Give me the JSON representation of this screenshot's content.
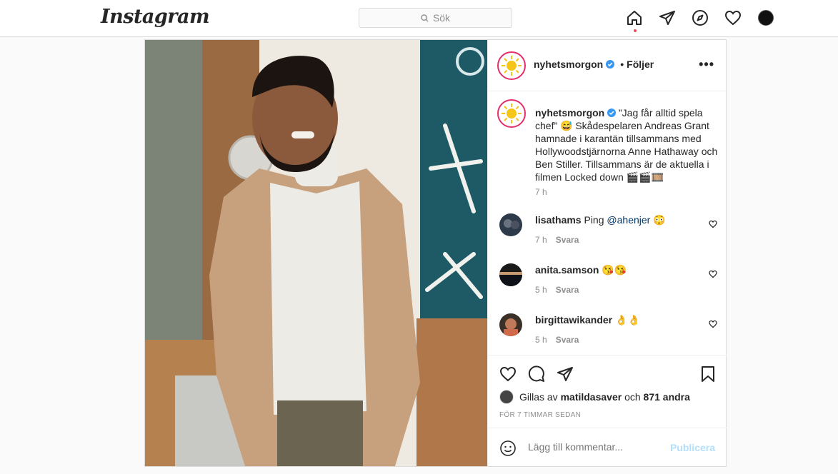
{
  "nav": {
    "logo": "Instagram",
    "search_placeholder": "Sök",
    "icons": [
      "home-icon",
      "direct-icon",
      "explore-icon",
      "activity-heart-icon",
      "profile-avatar"
    ]
  },
  "post": {
    "username": "nyhetsmorgon",
    "follow_separator": "•",
    "follow_label": "Följer",
    "more_label": "•••",
    "caption": "”Jag får alltid spela chef” 😅 Skådespelaren Andreas Grant hamnade i karantän tillsammans med Hollywoodstjärnorna Anne Hathaway och Ben Stiller. Tillsammans är de aktuella i filmen Locked down 🎬🎬🎞️",
    "caption_time": "7 h",
    "comments": [
      {
        "user": "lisathams",
        "text_before": "Ping ",
        "mention": "@ahenjer",
        "text_after": " 😳",
        "time": "7 h",
        "reply": "Svara"
      },
      {
        "user": "anita.samson",
        "text_before": "😘😘",
        "mention": "",
        "text_after": "",
        "time": "5 h",
        "reply": "Svara"
      },
      {
        "user": "birgittawikander",
        "text_before": "👌👌",
        "mention": "",
        "text_after": "",
        "time": "5 h",
        "reply": "Svara"
      }
    ],
    "likes": {
      "prefix": "Gillas av",
      "user": "matildasaver",
      "middle": "och",
      "count": "871 andra"
    },
    "timestamp": "FÖR 7 TIMMAR SEDAN",
    "add_comment_placeholder": "Lägg till kommentar...",
    "publish_label": "Publicera"
  },
  "colors": {
    "verified": "#3897f0",
    "notification_dot": "#ed4956",
    "publish_disabled": "#b2dffc",
    "border": "#dbdbdb"
  }
}
